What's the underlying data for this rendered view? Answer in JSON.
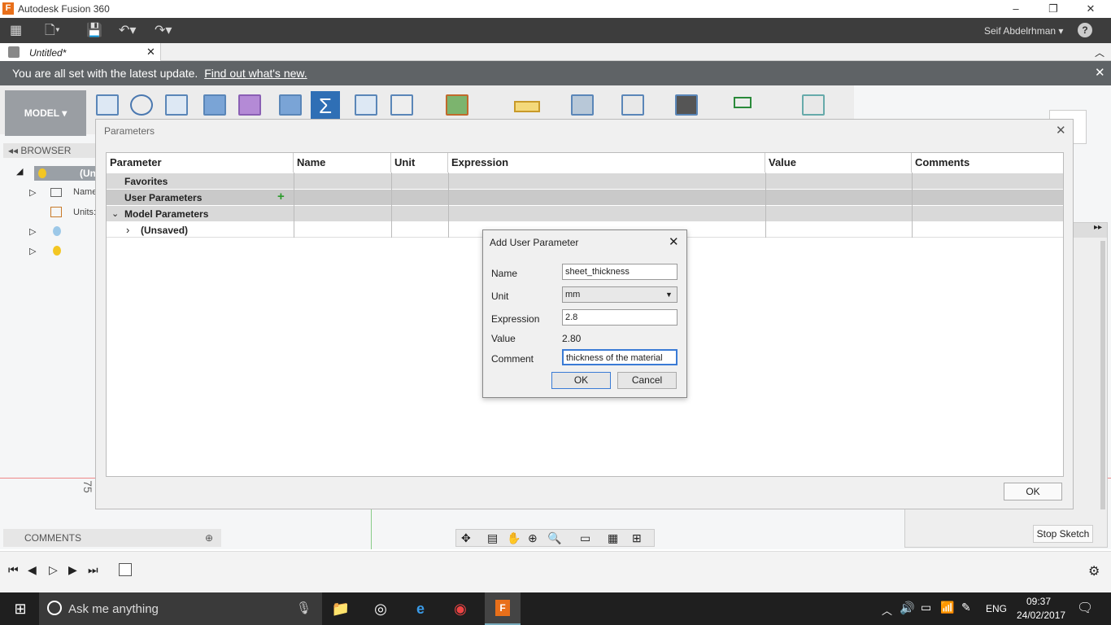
{
  "window": {
    "title": "Autodesk Fusion 360",
    "app_icon": "F"
  },
  "toolbar": {
    "user": "Seif Abdelrhman",
    "help": "?"
  },
  "tabs": [
    {
      "label": "Untitled*"
    }
  ],
  "notice": {
    "text": "You are all set with the latest update.",
    "link": "Find out what's new."
  },
  "ribbon": {
    "mode": "MODEL"
  },
  "browser": {
    "label": "BROWSER",
    "items": [
      "(Uns",
      "Name",
      "Units:"
    ]
  },
  "comments": {
    "label": "COMMENTS"
  },
  "canvas": {
    "ruler_label": "75"
  },
  "right_panel": {
    "stop_sketch": "Stop Sketch"
  },
  "params_dialog": {
    "title": "Parameters",
    "columns": [
      "Parameter",
      "Name",
      "Unit",
      "Expression",
      "Value",
      "Comments"
    ],
    "rows": [
      {
        "label": "Favorites"
      },
      {
        "label": "User Parameters"
      },
      {
        "label": "Model Parameters"
      },
      {
        "label": "(Unsaved)"
      }
    ],
    "ok": "OK"
  },
  "add_param": {
    "title": "Add User Parameter",
    "name_label": "Name",
    "name_value": "sheet_thickness",
    "unit_label": "Unit",
    "unit_value": "mm",
    "expr_label": "Expression",
    "expr_value": "2.8",
    "value_label": "Value",
    "value_value": "2.80",
    "comment_label": "Comment",
    "comment_value": "thickness of the material",
    "ok": "OK",
    "cancel": "Cancel"
  },
  "taskbar": {
    "search_placeholder": "Ask me anything",
    "lang": "ENG",
    "time": "09:37",
    "date": "24/02/2017"
  }
}
